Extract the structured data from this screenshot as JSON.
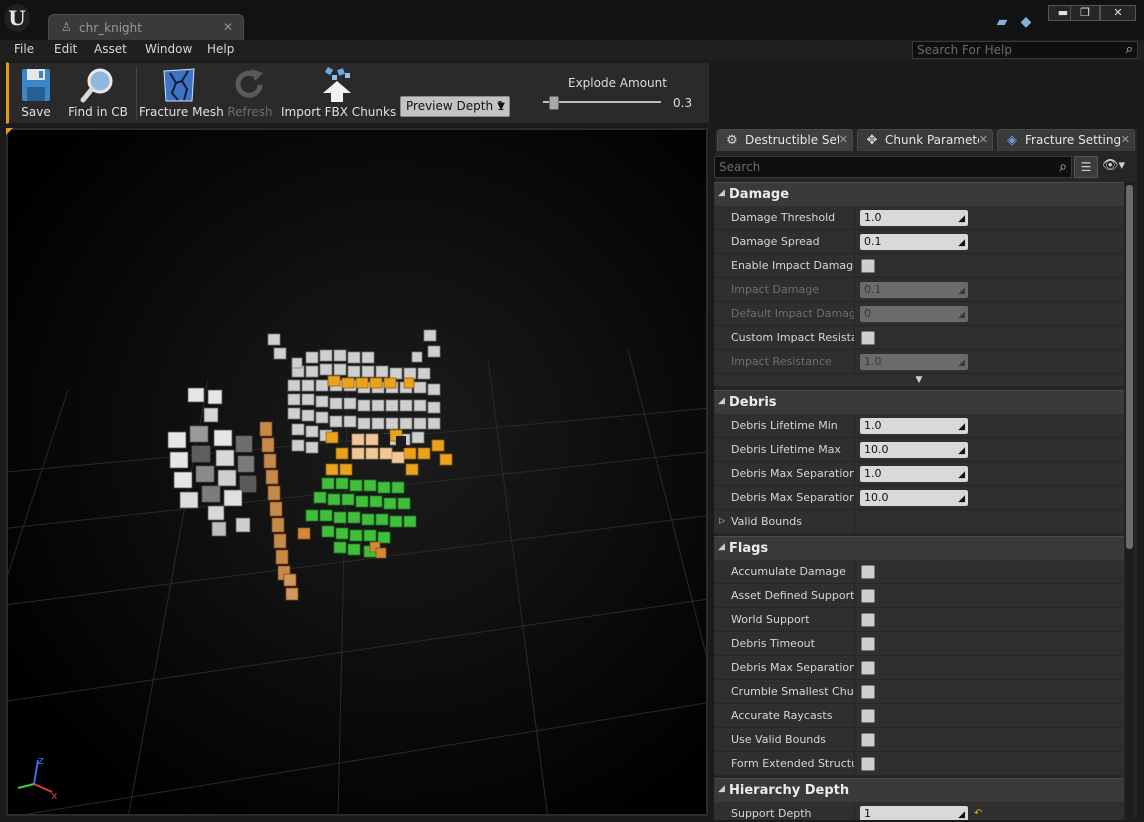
{
  "window": {
    "tab_title": "chr_knight",
    "minimize": "▬",
    "maximize": "❐",
    "close": "✕"
  },
  "menu": [
    "File",
    "Edit",
    "Asset",
    "Window",
    "Help"
  ],
  "help_search": {
    "placeholder": "Search For Help"
  },
  "toolbar": {
    "save": "Save",
    "find_in_cb": "Find in CB",
    "fracture_mesh": "Fracture Mesh",
    "refresh": "Refresh",
    "import_fbx": "Import FBX Chunks",
    "preview_depth": "Preview Depth 1",
    "explode_label": "Explode Amount",
    "explode_value": "0.3",
    "explode_fraction": 0.3
  },
  "panel": {
    "tabs": [
      {
        "label": "Destructible Setti",
        "icon": "gear-icon"
      },
      {
        "label": "Chunk Paramete",
        "icon": "chunk-icon"
      },
      {
        "label": "Fracture Settings",
        "icon": "fracture-icon"
      }
    ],
    "search_placeholder": "Search",
    "categories": {
      "damage": {
        "title": "Damage",
        "rows": [
          {
            "name": "Damage Threshold",
            "value": "1.0",
            "disabled": false
          },
          {
            "name": "Damage Spread",
            "value": "0.1",
            "disabled": false
          },
          {
            "name": "Enable Impact Damage",
            "checkbox": true,
            "disabled": false
          },
          {
            "name": "Impact Damage",
            "value": "0.1",
            "disabled": true
          },
          {
            "name": "Default Impact Damage D",
            "value": "0",
            "disabled": true
          },
          {
            "name": "Custom Impact Resistanc",
            "checkbox": true,
            "disabled": false
          },
          {
            "name": "Impact Resistance",
            "value": "1.0",
            "disabled": true
          }
        ]
      },
      "debris": {
        "title": "Debris",
        "rows": [
          {
            "name": "Debris Lifetime Min",
            "value": "1.0"
          },
          {
            "name": "Debris Lifetime Max",
            "value": "10.0"
          },
          {
            "name": "Debris Max Separation M",
            "value": "1.0"
          },
          {
            "name": "Debris Max Separation M",
            "value": "10.0"
          }
        ],
        "valid_bounds": "Valid Bounds"
      },
      "flags": {
        "title": "Flags",
        "rows": [
          "Accumulate Damage",
          "Asset Defined Support",
          "World Support",
          "Debris Timeout",
          "Debris Max Separation",
          "Crumble Smallest Chunks",
          "Accurate Raycasts",
          "Use Valid Bounds",
          "Form Extended Structures"
        ]
      },
      "hierarchy": {
        "title": "Hierarchy Depth",
        "support_depth_label": "Support Depth",
        "support_depth_value": "1"
      }
    }
  },
  "colors": {
    "accent_orange": "#e49a16",
    "field_bg": "#d9d9d9",
    "panel_bg": "#262626"
  }
}
